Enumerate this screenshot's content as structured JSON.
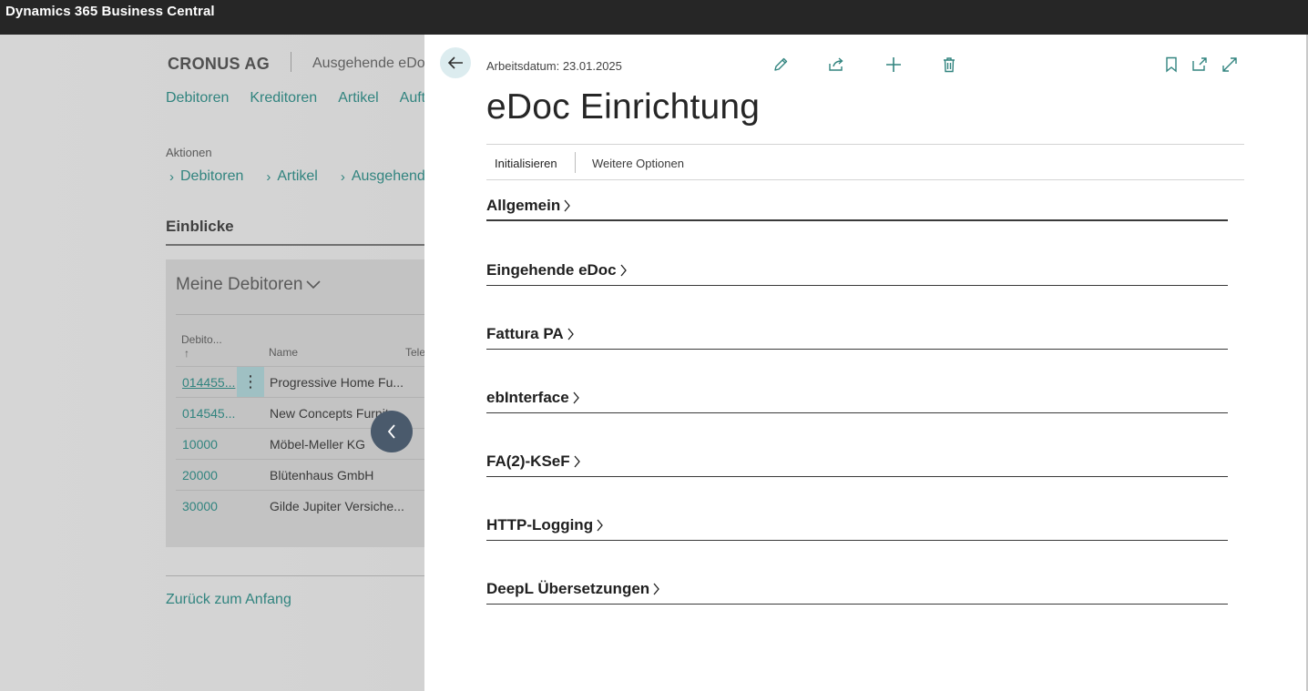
{
  "app": {
    "title": "Dynamics 365 Business Central"
  },
  "background": {
    "company": "CRONUS AG",
    "company_sub": "Ausgehende eDoc",
    "nav": [
      "Debitoren",
      "Kreditoren",
      "Artikel",
      "Aufträge"
    ],
    "actions_label": "Aktionen",
    "actions": [
      "Debitoren",
      "Artikel",
      "Ausgehende"
    ],
    "insights": "Einblicke",
    "card": {
      "title": "Meine Debitoren",
      "col_number": "Debito...",
      "col_sort": "↑",
      "col_name": "Name",
      "col_phone": "Tele",
      "rows": [
        {
          "number": "014455...",
          "name": "Progressive Home Fu..."
        },
        {
          "number": "014545...",
          "name": "New Concepts Furnit..."
        },
        {
          "number": "10000",
          "name": "Möbel-Meller KG"
        },
        {
          "number": "20000",
          "name": "Blütenhaus GmbH"
        },
        {
          "number": "30000",
          "name": "Gilde Jupiter Versiche..."
        }
      ]
    },
    "back_to_top": "Zurück zum Anfang"
  },
  "panel": {
    "work_date": "Arbeitsdatum: 23.01.2025",
    "title": "eDoc Einrichtung",
    "actions": {
      "initialize": "Initialisieren",
      "more_options": "Weitere Optionen"
    },
    "fasttabs": [
      "Allgemein",
      "Eingehende eDoc",
      "Fattura PA",
      "ebInterface",
      "FA(2)-KSeF",
      "HTTP-Logging",
      "DeepL Übersetzungen"
    ]
  },
  "colors": {
    "accent": "#31847f",
    "appbar": "#262626",
    "collapse_button": "#4a5a6c"
  }
}
